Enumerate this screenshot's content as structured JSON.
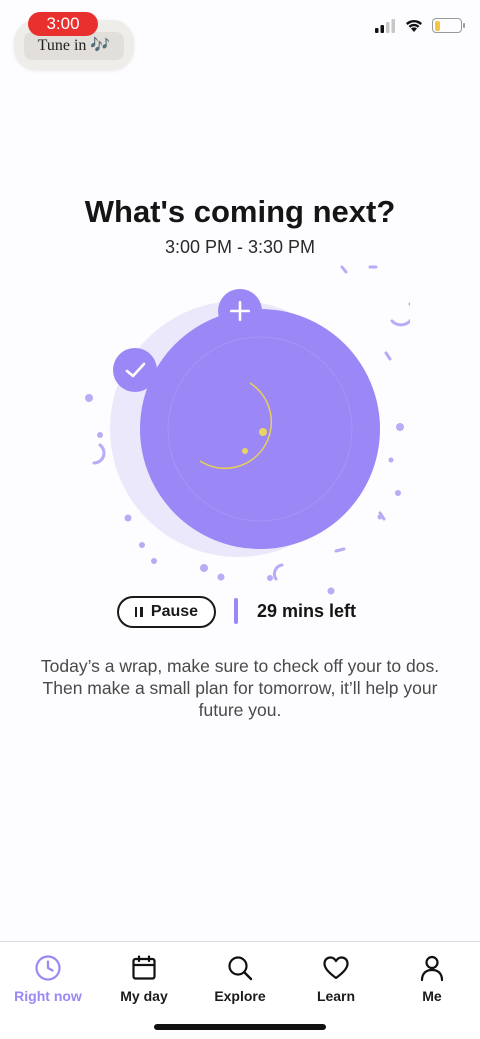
{
  "status_bar": {
    "time": "3:00",
    "chip_label": "Tune in 🎶",
    "icons": [
      "signal-icon",
      "wifi-icon",
      "battery-icon"
    ],
    "battery_level": 0.2
  },
  "header": {
    "title": "What's coming next?",
    "time_range": "3:00 PM - 3:30 PM"
  },
  "illustration": {
    "icons": [
      "add-icon",
      "check-icon",
      "moon-icon"
    ],
    "colors": {
      "primary": "#9b87f5",
      "light": "#ece8fb",
      "moon": "#f3e27a"
    }
  },
  "controls": {
    "pause_label": "Pause",
    "time_left": "29 mins left"
  },
  "message": "Today’s a wrap, make sure to check off your to dos. Then make a small plan for tomorrow, it’ll help your future you.",
  "tabs": [
    {
      "label": "Right now",
      "icon": "clock-icon",
      "active": true
    },
    {
      "label": "My day",
      "icon": "calendar-icon",
      "active": false
    },
    {
      "label": "Explore",
      "icon": "search-icon",
      "active": false
    },
    {
      "label": "Learn",
      "icon": "heart-icon",
      "active": false
    },
    {
      "label": "Me",
      "icon": "person-icon",
      "active": false
    }
  ],
  "colors": {
    "accent": "#9b87f5",
    "status_red": "#e8302f",
    "text": "#151515"
  }
}
